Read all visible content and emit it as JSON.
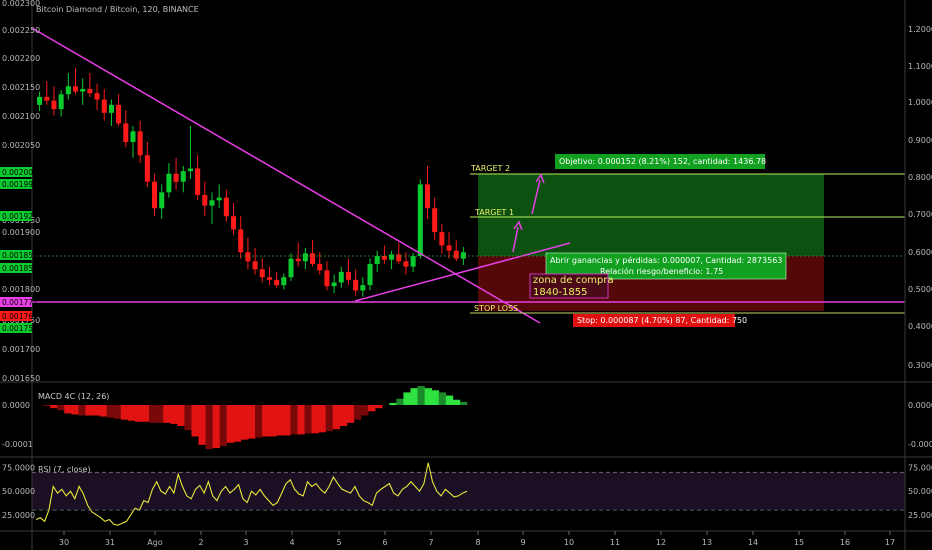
{
  "header": {
    "title": "Bitcoin Diamond / Bitcoin, 120, BINANCE"
  },
  "colors": {
    "up": "#0bcc2e",
    "down": "#ff1a1a",
    "trendline": "#e83fe6",
    "target_line": "#b8f060",
    "stop_line": "#c6d86a",
    "rsi": "#e8e83a",
    "profit_zone": "#0d5a12",
    "loss_zone": "#5a0808"
  },
  "chart_data": [
    {
      "type": "candlestick",
      "title": "Bitcoin Diamond / Bitcoin, 120, BINANCE",
      "x_ticks": [
        "30",
        "31",
        "Ago",
        "2",
        "3",
        "4",
        "5",
        "6",
        "7",
        "8",
        "9",
        "10",
        "11",
        "12",
        "13",
        "14",
        "15",
        "16",
        "17"
      ],
      "y_left_ticks": [
        "0.002250",
        "0.002200",
        "0.002150",
        "0.002100",
        "0.002050",
        "0.001950",
        "0.001900",
        "0.001800",
        "0.001750",
        "0.001700",
        "0.001650"
      ],
      "y_left_top_partial": "0.002300",
      "y_right_ticks": [
        "1.2000",
        "1.1000",
        "1.0000",
        "0.9000",
        "0.8000",
        "0.7000",
        "0.6000",
        "0.5000",
        "0.4000",
        "0.3000"
      ],
      "ylim": [
        0.00164,
        0.0023
      ],
      "price_labels": [
        {
          "text": "0.002004",
          "value": 0.002004,
          "color": "#0bcc2e"
        },
        {
          "text": "0.001995",
          "value": 0.001995,
          "color": "#0bcc2e"
        },
        {
          "text": "0.001925",
          "value": 0.001925,
          "color": "#0bcc2e"
        },
        {
          "text": "0.001859",
          "value": 0.001859,
          "color": "#0bcc2e"
        },
        {
          "text": "0.001852",
          "value": 0.001852,
          "color": "#0bcc2e"
        },
        {
          "text": "0.001777",
          "value": 0.001777,
          "color": "#e83fe6"
        },
        {
          "text": "0.001765",
          "value": 0.001765,
          "color": "#ff1a1a"
        },
        {
          "text": "0.001758",
          "value": 0.001758,
          "color": "#0bcc2e"
        }
      ],
      "levels": {
        "target2": 0.002004,
        "target1": 0.001925,
        "entry": 0.001859,
        "horizontal": 0.001777,
        "stop": 0.001758
      },
      "annotations": {
        "target2": "TARGET 2",
        "target1": "TARGET 1",
        "stop_loss": "STOP LOSS",
        "zona": "zona de compra",
        "zona_range": "1840-1855",
        "objetivo": "Objetivo: 0.000152 (8.21%) 152, cantidad: 1436.78",
        "abrir": "Abrir ganancias y pérdidas: 0.000007, Cantidad: 2873563",
        "relacion": "Relación riesgo/beneficio: 1.75",
        "stop_box": "Stop: 0.000087 (4.70%) 87, Cantidad: 750"
      },
      "candles": [
        [
          0.00214,
          0.002165,
          0.002128,
          0.002155
        ],
        [
          0.002155,
          0.002185,
          0.00214,
          0.002148
        ],
        [
          0.002148,
          0.002175,
          0.00212,
          0.002132
        ],
        [
          0.002132,
          0.002168,
          0.002118,
          0.00216
        ],
        [
          0.00216,
          0.0022,
          0.00215,
          0.002175
        ],
        [
          0.002175,
          0.00221,
          0.00216,
          0.002165
        ],
        [
          0.002165,
          0.00219,
          0.00214,
          0.00217
        ],
        [
          0.00217,
          0.0022,
          0.002155,
          0.002162
        ],
        [
          0.002162,
          0.00218,
          0.00213,
          0.00215
        ],
        [
          0.00215,
          0.00217,
          0.00211,
          0.002125
        ],
        [
          0.002125,
          0.00215,
          0.0021,
          0.00214
        ],
        [
          0.00214,
          0.00216,
          0.0021,
          0.002105
        ],
        [
          0.002105,
          0.00213,
          0.00206,
          0.00207
        ],
        [
          0.00207,
          0.0021,
          0.00204,
          0.00209
        ],
        [
          0.00209,
          0.00211,
          0.00203,
          0.002045
        ],
        [
          0.002045,
          0.00207,
          0.001985,
          0.001995
        ],
        [
          0.001995,
          0.00201,
          0.00193,
          0.001945
        ],
        [
          0.001945,
          0.00199,
          0.001925,
          0.001975
        ],
        [
          0.001975,
          0.00203,
          0.001965,
          0.00201
        ],
        [
          0.00201,
          0.00204,
          0.00198,
          0.001995
        ],
        [
          0.001995,
          0.002025,
          0.001975,
          0.002015
        ],
        [
          0.002015,
          0.0021,
          0.002,
          0.00202
        ],
        [
          0.00202,
          0.002045,
          0.00196,
          0.00197
        ],
        [
          0.00197,
          0.001995,
          0.00193,
          0.00195
        ],
        [
          0.00195,
          0.001975,
          0.001915,
          0.00196
        ],
        [
          0.00196,
          0.00199,
          0.001945,
          0.001965
        ],
        [
          0.001965,
          0.00198,
          0.00192,
          0.00193
        ],
        [
          0.00193,
          0.001955,
          0.001895,
          0.001905
        ],
        [
          0.001905,
          0.00193,
          0.00185,
          0.001862
        ],
        [
          0.001862,
          0.00189,
          0.00183,
          0.001845
        ],
        [
          0.001845,
          0.00187,
          0.00182,
          0.00183
        ],
        [
          0.00183,
          0.00185,
          0.001805,
          0.001815
        ],
        [
          0.001815,
          0.001835,
          0.0018,
          0.00181
        ],
        [
          0.00181,
          0.001825,
          0.001795,
          0.0018
        ],
        [
          0.0018,
          0.001822,
          0.001792,
          0.001815
        ],
        [
          0.001815,
          0.00186,
          0.001808,
          0.00185
        ],
        [
          0.00185,
          0.00188,
          0.001835,
          0.001845
        ],
        [
          0.001845,
          0.00187,
          0.00183,
          0.00186
        ],
        [
          0.00186,
          0.001885,
          0.001835,
          0.00184
        ],
        [
          0.00184,
          0.001862,
          0.00182,
          0.001828
        ],
        [
          0.001828,
          0.001845,
          0.00179,
          0.001798
        ],
        [
          0.001798,
          0.00182,
          0.001785,
          0.001805
        ],
        [
          0.001805,
          0.001835,
          0.001795,
          0.001825
        ],
        [
          0.001825,
          0.00185,
          0.0018,
          0.00181
        ],
        [
          0.00181,
          0.00183,
          0.00178,
          0.00179
        ],
        [
          0.00179,
          0.001815,
          0.001778,
          0.0018
        ],
        [
          0.0018,
          0.00185,
          0.00179,
          0.00184
        ],
        [
          0.00184,
          0.001865,
          0.001825,
          0.001855
        ],
        [
          0.001855,
          0.001875,
          0.00184,
          0.001848
        ],
        [
          0.001848,
          0.001865,
          0.00183,
          0.001858
        ],
        [
          0.001858,
          0.00188,
          0.00184,
          0.001845
        ],
        [
          0.001845,
          0.001862,
          0.00182,
          0.001835
        ],
        [
          0.001835,
          0.00186,
          0.001825,
          0.001855
        ],
        [
          0.001855,
          0.002,
          0.00185,
          0.00199
        ],
        [
          0.00199,
          0.002025,
          0.001925,
          0.001945
        ],
        [
          0.001945,
          0.001965,
          0.001885,
          0.0019
        ],
        [
          0.0019,
          0.001915,
          0.00186,
          0.001875
        ],
        [
          0.001875,
          0.0019,
          0.00185,
          0.001865
        ],
        [
          0.001865,
          0.001885,
          0.001845,
          0.00185
        ],
        [
          0.00185,
          0.001872,
          0.001838,
          0.001862
        ]
      ]
    },
    {
      "type": "bar",
      "title": "MACD 4C (12, 26)",
      "y_ticks": [
        "0.0000",
        "-0.0001"
      ],
      "values": [
        0,
        -1,
        -3,
        -5,
        -8,
        -9,
        -10,
        -10,
        -10,
        -11,
        -12,
        -13,
        -14,
        -15,
        -16,
        -16,
        -17,
        -17,
        -17,
        -18,
        -20,
        -24,
        -30,
        -38,
        -42,
        -41,
        -39,
        -36,
        -35,
        -33,
        -32,
        -31,
        -30,
        -30,
        -29,
        -29,
        -28,
        -28,
        -27,
        -27,
        -26,
        -25,
        -23,
        -20,
        -17,
        -14,
        -10,
        -6,
        -3,
        0,
        2,
        6,
        12,
        16,
        18,
        16,
        14,
        12,
        9,
        5,
        3
      ]
    },
    {
      "type": "line",
      "title": "RSI (7, close)",
      "y_ticks": [
        "75.0000",
        "50.0000",
        "25.0000"
      ],
      "ylim": [
        10,
        83
      ],
      "bands": [
        70,
        30
      ],
      "values": [
        20,
        22,
        18,
        30,
        55,
        48,
        52,
        45,
        50,
        42,
        55,
        47,
        35,
        28,
        25,
        22,
        18,
        20,
        15,
        14,
        16,
        18,
        25,
        32,
        30,
        40,
        38,
        52,
        60,
        50,
        47,
        55,
        48,
        68,
        55,
        45,
        42,
        52,
        56,
        48,
        60,
        45,
        40,
        50,
        55,
        48,
        52,
        57,
        42,
        38,
        50,
        46,
        52,
        45,
        40,
        35,
        38,
        48,
        58,
        62,
        52,
        47,
        45,
        60,
        55,
        58,
        52,
        48,
        55,
        65,
        58,
        52,
        50,
        48,
        55,
        45,
        40,
        38,
        35,
        48,
        52,
        55,
        58,
        48,
        45,
        52,
        55,
        60,
        55,
        50,
        58,
        80,
        60,
        50,
        45,
        52,
        48,
        44,
        45,
        48,
        50
      ]
    }
  ]
}
